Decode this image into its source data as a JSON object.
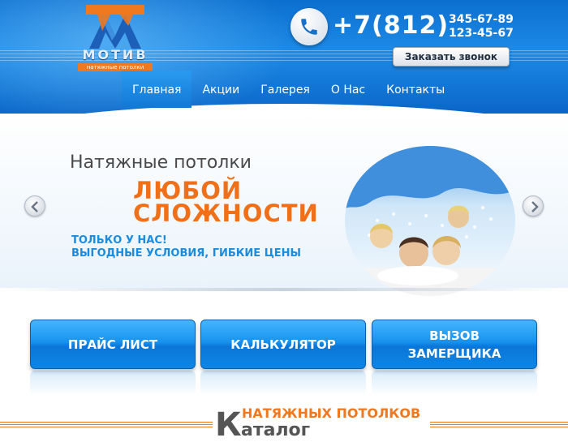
{
  "brand": {
    "name": "МОТИВ",
    "tagline": "натяжные потолки"
  },
  "contact": {
    "phone_code": "+7(812)",
    "phone_numbers": [
      "345-67-89",
      "123-45-67"
    ],
    "callback_label": "Заказать звонок"
  },
  "nav": {
    "items": [
      {
        "label": "Главная",
        "active": true
      },
      {
        "label": "Акции",
        "active": false
      },
      {
        "label": "Галерея",
        "active": false
      },
      {
        "label": "О Нас",
        "active": false
      },
      {
        "label": "Контакты",
        "active": false
      }
    ]
  },
  "slider": {
    "subtitle": "Натяжные потолки",
    "headline": [
      "ЛЮБОЙ",
      "СЛОЖНОСТИ"
    ],
    "promo": [
      "ТОЛЬКО У НАС!",
      "ВЫГОДНЫЕ УСЛОВИЯ, ГИБКИЕ ЦЕНЫ"
    ]
  },
  "actions": {
    "price_list": "ПРАЙС ЛИСТ",
    "calculator": "КАЛЬКУЛЯТОР",
    "measurer": [
      "ВЫЗОВ",
      "ЗАМЕРЩИКА"
    ]
  },
  "catalog": {
    "top": "НАТЯЖНЫХ ПОТОЛКОВ",
    "first_letter": "К",
    "rest": "аталог"
  },
  "colors": {
    "brand_blue": "#1177d6",
    "accent_orange": "#f0781e",
    "text_gray": "#555555"
  },
  "icons": [
    "logo-mark-icon",
    "phone-icon",
    "chevron-left-icon",
    "chevron-right-icon"
  ]
}
